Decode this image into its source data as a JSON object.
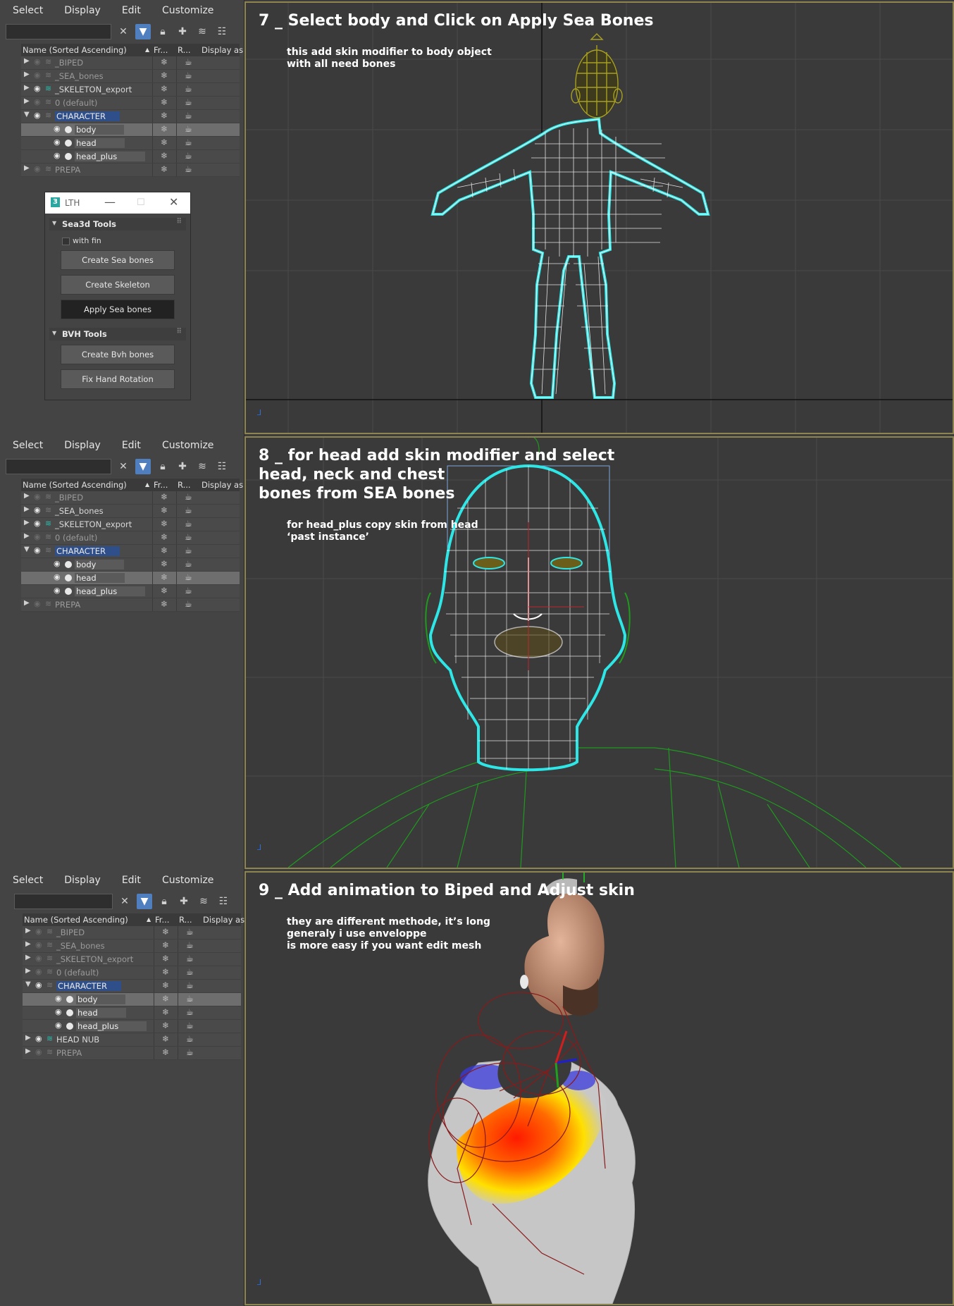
{
  "menu": [
    "Select",
    "Display",
    "Edit",
    "Customize"
  ],
  "toolbar_icons": [
    "clear-search-icon",
    "filter-icon",
    "lock-icon",
    "add-layer-icon",
    "layers-icon",
    "hierarchy-icon"
  ],
  "columns": {
    "name": "Name (Sorted Ascending)",
    "sort": "▲",
    "frozen": "Fr...",
    "render": "R...",
    "display": "Display as"
  },
  "glyphs": {
    "freeze": "❄",
    "render": "☕"
  },
  "panels": [
    {
      "rows": [
        {
          "name": "_BIPED",
          "type": "layer",
          "expanded": false,
          "visible": false,
          "dim": true
        },
        {
          "name": "_SEA_bones",
          "type": "layer",
          "expanded": false,
          "visible": false,
          "dim": true
        },
        {
          "name": "_SKELETON_export",
          "type": "layer",
          "expanded": false,
          "visible": true,
          "dim": false,
          "teal": true
        },
        {
          "name": "0 (default)",
          "type": "layer",
          "expanded": false,
          "visible": false,
          "dim": true
        },
        {
          "name": "CHARACTER",
          "type": "layer",
          "expanded": true,
          "visible": true,
          "dim": false,
          "highlight": true
        },
        {
          "name": "body",
          "type": "object",
          "visible": true,
          "selected": true
        },
        {
          "name": "head",
          "type": "object",
          "visible": true,
          "selected": false
        },
        {
          "name": "head_plus",
          "type": "object",
          "visible": true,
          "selected": false
        },
        {
          "name": "PREPA",
          "type": "layer",
          "expanded": false,
          "visible": false,
          "dim": true
        }
      ],
      "viewport": {
        "title": "7 _ Select body and Click on Apply Sea Bones",
        "note": "this add skin modifier to body object\nwith all need bones"
      }
    },
    {
      "rows": [
        {
          "name": "_BIPED",
          "type": "layer",
          "expanded": false,
          "visible": false,
          "dim": true
        },
        {
          "name": "_SEA_bones",
          "type": "layer",
          "expanded": false,
          "visible": true,
          "dim": false
        },
        {
          "name": "_SKELETON_export",
          "type": "layer",
          "expanded": false,
          "visible": true,
          "dim": false,
          "teal": true
        },
        {
          "name": "0 (default)",
          "type": "layer",
          "expanded": false,
          "visible": false,
          "dim": true
        },
        {
          "name": "CHARACTER",
          "type": "layer",
          "expanded": true,
          "visible": true,
          "dim": false,
          "highlight": true
        },
        {
          "name": "body",
          "type": "object",
          "visible": true,
          "selected": false
        },
        {
          "name": "head",
          "type": "object",
          "visible": true,
          "selected": true
        },
        {
          "name": "head_plus",
          "type": "object",
          "visible": true,
          "selected": false
        },
        {
          "name": "PREPA",
          "type": "layer",
          "expanded": false,
          "visible": false,
          "dim": true
        }
      ],
      "viewport": {
        "title": "8 _ for head add skin modifier and select\nhead, neck and chest\nbones from SEA bones",
        "note": "for head_plus copy skin from head\n‘past instance’"
      }
    },
    {
      "rows": [
        {
          "name": "_BIPED",
          "type": "layer",
          "expanded": false,
          "visible": false,
          "dim": true
        },
        {
          "name": "_SEA_bones",
          "type": "layer",
          "expanded": false,
          "visible": false,
          "dim": true
        },
        {
          "name": "_SKELETON_export",
          "type": "layer",
          "expanded": false,
          "visible": false,
          "dim": true
        },
        {
          "name": "0 (default)",
          "type": "layer",
          "expanded": false,
          "visible": false,
          "dim": true
        },
        {
          "name": "CHARACTER",
          "type": "layer",
          "expanded": true,
          "visible": true,
          "dim": false,
          "highlight": true
        },
        {
          "name": "body",
          "type": "object",
          "visible": true,
          "selected": true
        },
        {
          "name": "head",
          "type": "object",
          "visible": true,
          "selected": false
        },
        {
          "name": "head_plus",
          "type": "object",
          "visible": true,
          "selected": false
        },
        {
          "name": "HEAD NUB",
          "type": "layer",
          "expanded": false,
          "visible": true,
          "dim": false,
          "teal": true
        },
        {
          "name": "PREPA",
          "type": "layer",
          "expanded": false,
          "visible": false,
          "dim": true
        }
      ],
      "viewport": {
        "title": "9 _ Add animation to Biped and Adjust skin",
        "note": "they are different methode, it’s long\ngeneraly i use enveloppe\nis more easy if you want edit mesh"
      }
    }
  ],
  "lth_window": {
    "title": "LTH",
    "logo": "3",
    "controls": {
      "minimize": "—",
      "maximize": "☐",
      "close": "✕"
    },
    "sea3d": {
      "header": "Sea3d Tools",
      "checkbox_label": "with fin",
      "checked": false,
      "buttons": [
        "Create Sea bones",
        "Create Skeleton",
        "Apply Sea bones"
      ]
    },
    "bvh": {
      "header": "BVH Tools",
      "buttons": [
        "Create Bvh bones",
        "Fix Hand Rotation"
      ]
    }
  },
  "colors": {
    "wire_selected": "#2ee6e6",
    "wire_white": "#ffffff",
    "wire_green": "#1f9a1f",
    "wire_olive": "#a8a020",
    "viewport_border": "#8e8450"
  }
}
